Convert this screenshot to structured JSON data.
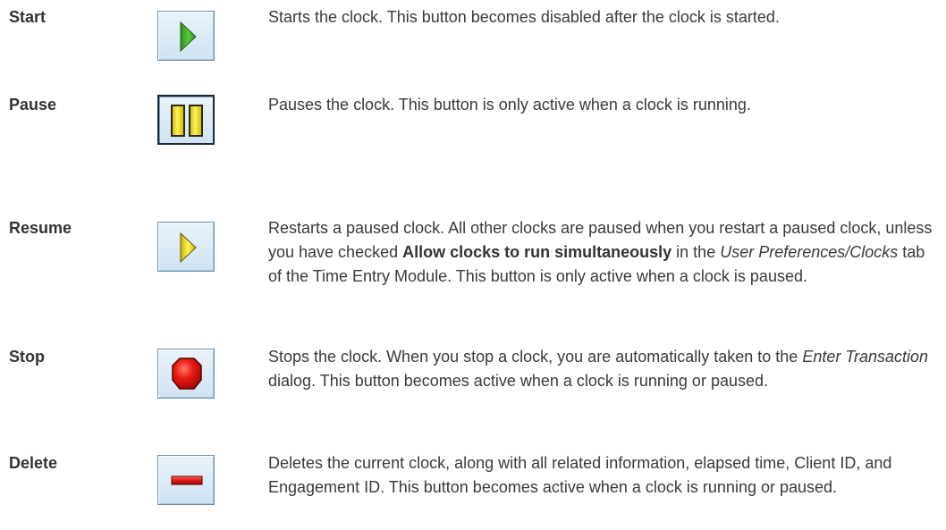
{
  "buttons": [
    {
      "label": "Start",
      "icon": "play-green-icon",
      "desc": [
        "Starts the clock. This button becomes disabled after the clock is started."
      ]
    },
    {
      "label": "Pause",
      "icon": "pause-yellow-icon",
      "desc": [
        "Pauses the clock. This button is only active when a clock is running."
      ]
    },
    {
      "label": "Resume",
      "icon": "play-yellow-icon",
      "desc": [
        "Restarts a paused clock. All other clocks are paused when you restart a paused clock, unless you have checked ",
        "Allow clocks to run simultaneously",
        " in the ",
        "User Preferences/Clocks",
        " tab of the Time Entry Module. This button is only active when a clock is paused."
      ]
    },
    {
      "label": "Stop",
      "icon": "stop-red-icon",
      "desc": [
        "Stops the clock. When you stop a clock, you are automatically taken to the ",
        "Enter Transaction",
        " dialog. This button becomes active when a clock is running or paused."
      ]
    },
    {
      "label": "Delete",
      "icon": "delete-red-bar-icon",
      "desc": [
        "Deletes the current clock, along with all related information, elapsed time, Client ID, and Engagement ID. This button becomes active when a clock is running or paused."
      ]
    }
  ],
  "colors": {
    "text": "#3a3a3a",
    "button_border": "#6a8fb0",
    "button_fill": "#dbe9f5",
    "play_green": "#3fae2a",
    "pause_yellow": "#f2e01a",
    "stop_red": "#e01818"
  }
}
